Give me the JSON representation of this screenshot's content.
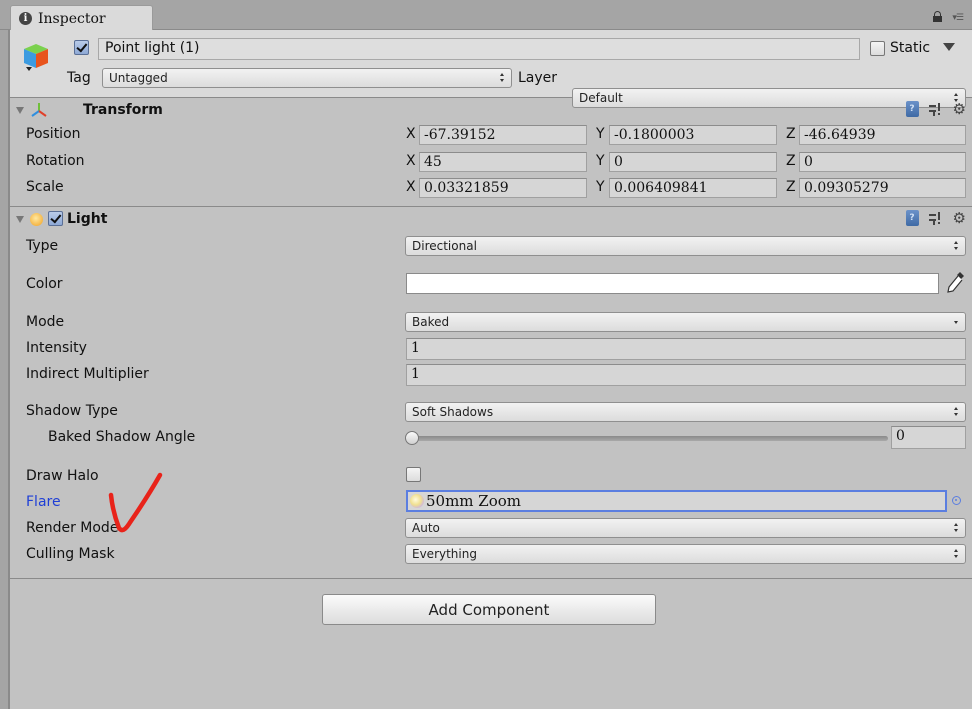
{
  "window": {
    "tab_label": "Inspector",
    "tab_icon": "info-icon"
  },
  "header": {
    "active": true,
    "object_name": "Point light (1)",
    "static_label": "Static",
    "static_checked": false,
    "tag_label": "Tag",
    "tag_value": "Untagged",
    "layer_label": "Layer",
    "layer_value": "Default"
  },
  "transform": {
    "title": "Transform",
    "rows": [
      {
        "label": "Position",
        "x": "-67.39152",
        "y": "-0.1800003",
        "z": "-46.64939"
      },
      {
        "label": "Rotation",
        "x": "45",
        "y": "0",
        "z": "0"
      },
      {
        "label": "Scale",
        "x": "0.03321859",
        "y": "0.006409841",
        "z": "0.09305279"
      }
    ],
    "axis_labels": {
      "x": "X",
      "y": "Y",
      "z": "Z"
    }
  },
  "light": {
    "title": "Light",
    "enabled": true,
    "type_label": "Type",
    "type_value": "Directional",
    "color_label": "Color",
    "color_value": "#ffffff",
    "mode_label": "Mode",
    "mode_value": "Baked",
    "intensity_label": "Intensity",
    "intensity_value": "1",
    "indirect_label": "Indirect Multiplier",
    "indirect_value": "1",
    "shadow_type_label": "Shadow Type",
    "shadow_type_value": "Soft Shadows",
    "baked_angle_label": "Baked Shadow Angle",
    "baked_angle_value": "0",
    "draw_halo_label": "Draw Halo",
    "draw_halo_checked": false,
    "flare_label": "Flare",
    "flare_value": "50mm Zoom",
    "render_mode_label": "Render Mode",
    "render_mode_value": "Auto",
    "culling_mask_label": "Culling Mask",
    "culling_mask_value": "Everything"
  },
  "add_component_label": "Add Component",
  "colors": {
    "panel_bg": "#c2c2c2",
    "header_bg": "#dadada",
    "focus_blue": "#5b7ee0",
    "highlight_label": "#1f3fd6",
    "annotation_red": "#e8231a"
  }
}
